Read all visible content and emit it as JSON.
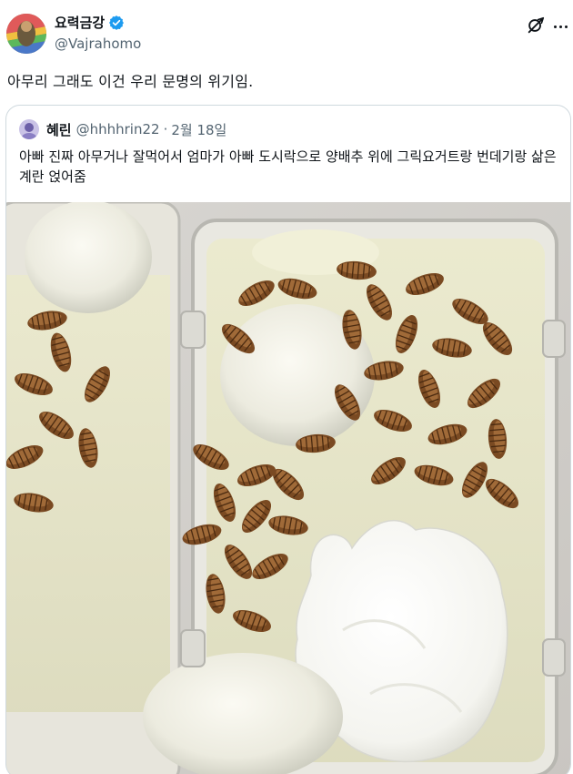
{
  "post": {
    "display_name": "요력금강",
    "handle": "@Vajrahomo",
    "text": "아무리 그래도 이건 우리 문명의 위기임.",
    "verified": true
  },
  "quoted_post": {
    "display_name": "혜린",
    "handle": "@hhhhrin22",
    "separator": "·",
    "date": "2월 18일",
    "text": "아빠 진짜 아무거나 잘먹어서 엄마가 아빠 도시락으로 양배추 위에 그릭요거트랑 번데기랑 삶은계란 얹어줌"
  },
  "icons": {
    "verified": "verified-badge-icon",
    "grok": "grok-icon",
    "more": "more-options-icon"
  },
  "colors": {
    "text_primary": "#0f1419",
    "text_secondary": "#536471",
    "verified_blue": "#1d9bf0",
    "border": "#cfd9de"
  }
}
